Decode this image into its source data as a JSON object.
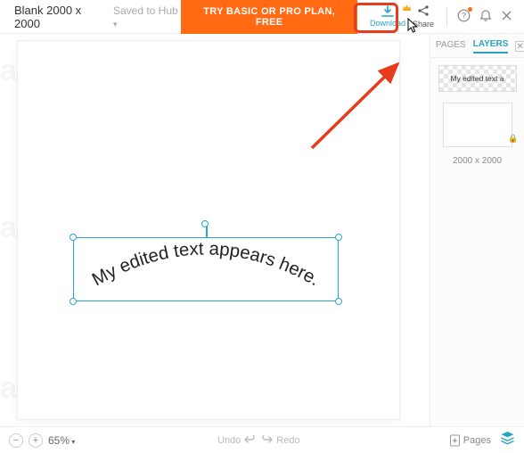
{
  "header": {
    "title": "Blank 2000 x 2000",
    "saved": "Saved to Hub",
    "cta": "TRY BASIC OR PRO PLAN, FREE",
    "download": "Download",
    "share": "Share"
  },
  "canvas": {
    "curved_text": "My edited text appears here."
  },
  "watermark": "alphr",
  "side": {
    "tabs": {
      "pages": "PAGES",
      "layers": "LAYERS"
    },
    "layer_preview": "My edited text a",
    "dims": "2000 x 2000"
  },
  "bottom": {
    "zoom": "65%",
    "undo": "Undo",
    "redo": "Redo",
    "pages": "Pages"
  }
}
